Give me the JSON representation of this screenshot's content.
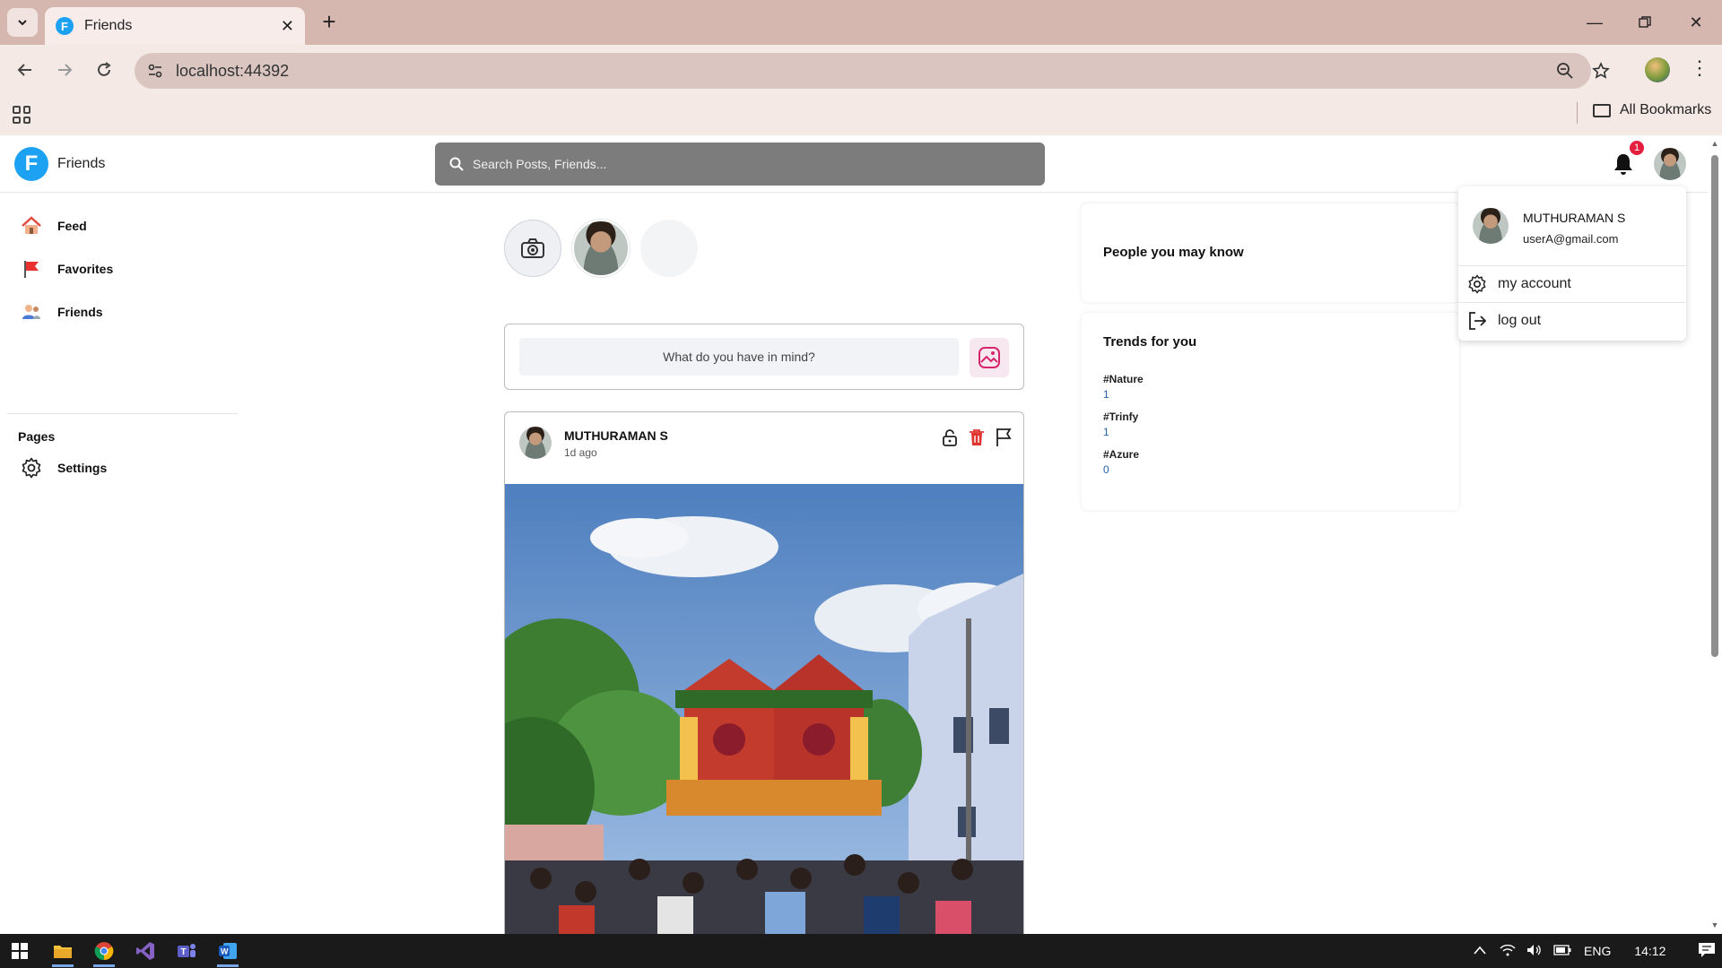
{
  "browser": {
    "tab_title": "Friends",
    "tab_favicon_letter": "F",
    "url": "localhost:44392",
    "bookmarks_label": "All Bookmarks"
  },
  "app": {
    "logo_letter": "F",
    "brand": "Friends",
    "search_placeholder": "Search Posts, Friends...",
    "notification_count": "1"
  },
  "sidebar": {
    "items": [
      {
        "label": "Feed",
        "icon": "home-icon"
      },
      {
        "label": "Favorites",
        "icon": "flag-icon"
      },
      {
        "label": "Friends",
        "icon": "people-icon"
      }
    ],
    "pages_heading": "Pages",
    "pages_items": [
      {
        "label": "Settings",
        "icon": "gear-icon"
      }
    ]
  },
  "composer": {
    "placeholder": "What do you have in mind?"
  },
  "post": {
    "author": "MUTHURAMAN S",
    "time": "1d ago"
  },
  "people_card": {
    "title": "People you may know"
  },
  "trends_card": {
    "title": "Trends for you",
    "trends": [
      {
        "tag": "#Nature",
        "count": "1"
      },
      {
        "tag": "#Trinfy",
        "count": "1"
      },
      {
        "tag": "#Azure",
        "count": "0"
      }
    ]
  },
  "account_menu": {
    "name": "MUTHURAMAN S",
    "email": "userA@gmail.com",
    "my_account": "my account",
    "log_out": "log out"
  },
  "taskbar": {
    "language": "ENG",
    "time": "14:12"
  },
  "colors": {
    "brand_blue": "#1da1f2",
    "badge_red": "#e41e3f",
    "chrome_tab_strip": "#d6b7b0"
  }
}
